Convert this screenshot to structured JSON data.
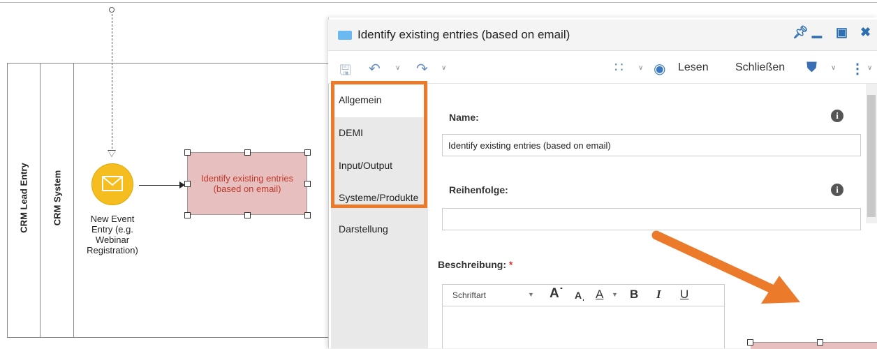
{
  "diagram": {
    "pool_label": "CRM Lead Entry",
    "lane_label": "CRM System",
    "event_label": "New Event Entry (e.g. Webinar Registration)",
    "task_label": "Identify existing entries (based on email)",
    "colors": {
      "event": "#f5bd1f",
      "task_fill": "#e8bfbf",
      "task_text": "#c0392b"
    }
  },
  "dialog": {
    "title": "Identify existing entries (based on email)",
    "window_controls": [
      "pin-icon",
      "minimize-icon",
      "maximize-icon",
      "close-icon"
    ],
    "toolbar": {
      "read_label": "Lesen",
      "close_label": "Schließen"
    },
    "tabs": [
      {
        "label": "Allgemein",
        "active": true
      },
      {
        "label": "DEMI"
      },
      {
        "label": "Input/Output"
      },
      {
        "label": "Systeme/Produkte"
      },
      {
        "label": "Darstellung"
      }
    ],
    "form": {
      "name_label": "Name:",
      "name_value": "Identify existing entries (based on email)",
      "order_label": "Reihenfolge:",
      "order_value": "",
      "description_label": "Beschreibung:",
      "required_mark": "*",
      "font_select": "Schriftart"
    },
    "accent_color": "#ec7a2b"
  }
}
